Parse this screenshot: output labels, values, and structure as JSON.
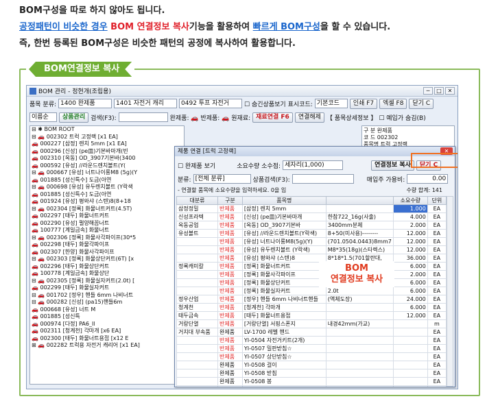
{
  "intro": {
    "line1": "BOM구성을 따로 하지 않아도 됩니다.",
    "line2_a": "공정패턴이 비슷한 경우",
    "line2_b": " BOM 연결정보 복사",
    "line2_c": "기능을 활용하여 ",
    "line2_d": "빠르게 BOM구성",
    "line2_e": "을 할 수 있습니다.",
    "line3": "즉, 한번 등록된 BOM구성은 비슷한 패턴의 공정에 복사하여 활용합니다."
  },
  "section_tag": "BOM연결정보 복사",
  "bom_window": {
    "title": "BOM 관리 - 정현개(조립용)",
    "window_buttons": [
      "─",
      "□",
      "✕"
    ],
    "toolbar1": {
      "category_label": "품목 분류:",
      "category_value": "1400 완제품",
      "sub1": "1401 자전거 캐리",
      "sub2": "0492 투프 자전거",
      "check_label": "☐ 숨긴상품보기",
      "display_code_label": "표시코드:",
      "display_code_value": "기본코드",
      "print": "인쇄 F7",
      "excel": "엑셀 F8",
      "close": "닫기 C"
    },
    "toolbar2": {
      "sort_value": "이름순",
      "product_manage": "상품관리",
      "search_label": "검색(F3):",
      "legend": "완제품: 🚗 반제품: 🚗 원재료:",
      "copy_btn": "재료연결 F6",
      "connect_btn": "연결해제",
      "detail": "【 품목상세정보 】",
      "input_check": "☐ 예입가 숨김(B)"
    },
    "right_panel": {
      "rows": [
        "구  분  완제품",
        "코  드  002302",
        "품목명  트럭 고정랙"
      ]
    },
    "tree": [
      "⊟ ✱ BOM ROOT",
      "  ⊟ 🚗 002302 트럭 고정랙 [x1 EA]",
      "      🚗 000227 [삼정] 렌치 5mm [x1 EA]",
      "      🚗 000296 [신성] (pe皿)기본바마개(빈",
      "      🚗 002310 [옥동] OD_3907기본바(3400",
      "      🚗 000592 [유성] //라운드렌치볼트(Y(",
      "    ⊟ 🚗 000667 [유성] 너트나이롱M8 (5g)(Y",
      "        🚗 001885 [성신특수] 도금(아연",
      "    ⊟ 🚗 000698 [유성] 유두렌치볼트 (Y락색",
      "        🚗 001885 [성신특수] 도금(아연",
      "      🚗 001924 [유성] 평와샤 (스텐)8(8+18",
      "    ⊟ 🚗 002304 [정록] 화물너트커트(4.5T)",
      "        🚗 002297 [태두] 화물너트커트",
      "        🚗 002290 [유성] 펄양해꼽너트",
      "        🚗 100777 [계일금속] 화물너트",
      "    ⊟ 🚗 002306 [정록] 화물사각파이프(30*5",
      "        🚗 002298 [태두] 화물각파이프",
      "        🚗 002307 [한양] 화물사각파이프",
      "    ⊟ 🚗 002303 [정록] 화물상단커트(6T) [x",
      "        🚗 002296 [태두] 화물상단커트",
      "        🚗 100778 [계일금속] 화물상단",
      "    ⊟ 🚗 002305 [정록] 화물실자커트(2.0t) [",
      "        🚗 002299 [태두] 화물실자커트",
      "    ⊟ 🚗 001702 [정우] 핸들 6mm 나비너트",
      "      ⊟ 🚗 000282 [신성] (pa15)핸들6m",
      "          🚗 000668 [유성] 너트 M",
      "            🚗 001885 [성신특",
      "          🚗 000974 [다정] PA6_Il",
      "      🚗 002311 [청계천] 각마개 [x6 EA]",
      "      🚗 002300 [태두] 화물너트용접 [x12 E",
      "  ⊞ 🚗 002282 트럭용 자전거 캐리어 [x1 EA]"
    ]
  },
  "dialog": {
    "title": "제품 연결 [트럭 고정랙]",
    "show_parts": "☐ 완제품 보기",
    "qty_label": "소요수량 소수점:",
    "qty_value": "세자리(1,000)",
    "copy_btn": "연결정보 복사",
    "close_btn": "닫기 C",
    "cat_label": "분류:",
    "cat_value": "[전체 분류]",
    "search_label": "상품검색(F3):",
    "price_label": "매입주 가용비:",
    "price_value": "0.00",
    "note": "- 연결할 품목에 소요수량을 입력하세요. 0을 입",
    "total": "수량 합계: 141",
    "headers": [
      "대분류",
      "구분",
      "품목명",
      "",
      "소요수량",
      "단위"
    ],
    "rows": [
      [
        "삼정정밀",
        "반제품",
        "[삼정] 렌치 5mm",
        "",
        "1.000",
        "EA"
      ],
      [
        "신성프라텍",
        "반제품",
        "[신성] (pe皿)기본바마개",
        "한참722_16g(사출)",
        "4.000",
        "EA"
      ],
      [
        "옥동공업",
        "반제품",
        "[옥동] OD_3907기본바",
        "3400mm분체",
        "2.000",
        "EA"
      ],
      [
        "유성볼트",
        "반제품",
        "[유성] //라운드렌치볼트(Y락색)",
        "8+50(미사용)--------",
        "12.000",
        "EA"
      ],
      [
        "",
        "반제품",
        "[유성] 너트나이롱M8(5g)(Y)",
        "(701.0504.0443)8mm7",
        "12.000",
        "EA"
      ],
      [
        "",
        "반제품",
        "[유성] 유두렌치볼트 (Y락색)",
        "M8*35(18g)(스타렉스)",
        "12.000",
        "EA"
      ],
      [
        "",
        "반제품",
        "[유성] 평와샤 (스텐)8",
        "8*18*1.5(701할란대,",
        "36.000",
        "EA"
      ],
      [
        "정록캐미칼",
        "반제품",
        "[정록] 화물너트커트",
        "4.5T",
        "6.000",
        "EA"
      ],
      [
        "",
        "반제품",
        "[정록] 화물사각파이프",
        "30*50*1.4t",
        "2.000",
        "EA"
      ],
      [
        "",
        "반제품",
        "[정록] 화물상단커트",
        "6T",
        "6.000",
        "EA"
      ],
      [
        "",
        "반제품",
        "[정록] 화물실자커트",
        "2.0t",
        "6.000",
        "EA"
      ],
      [
        "정우산업",
        "반제품",
        "[정우] 핸들 6mm 나비너트핸들",
        "(액체도장)",
        "24.000",
        "EA"
      ],
      [
        "청계천",
        "반제품",
        "[청계천] 각마개",
        "",
        "6.000",
        "EA"
      ],
      [
        "태두금속",
        "반제품",
        "[태두] 화물너트용접",
        "",
        "12.000",
        "EA"
      ],
      [
        "거랑단열",
        "반제품",
        "[거랑단열] 서핑스폰지",
        "내경42mm(가교)",
        "",
        "m"
      ],
      [
        "거치대 부속품",
        "완제품",
        "LV-1700 레벨 핸드",
        "",
        "",
        "EA"
      ],
      [
        "",
        "반제품",
        "YI-0504 자전거키트(2개)",
        "",
        "",
        "EA"
      ],
      [
        "",
        "반제품",
        "YI-0507 밀판받침☆",
        "",
        "",
        "EA"
      ],
      [
        "",
        "반제품",
        "YI-0507 상단받침☆",
        "",
        "",
        "EA"
      ],
      [
        "",
        "완제품",
        "YI-0508 걸이",
        "",
        "",
        "EA"
      ],
      [
        "",
        "완제품",
        "YI-0508 받침",
        "",
        "",
        "EA"
      ],
      [
        "",
        "완제품",
        "YI-0508 봉",
        "",
        "",
        "EA"
      ],
      [
        "",
        "완제품",
        "YI-052 파이프 옷걸이☆",
        "580*3",
        "",
        "EA"
      ]
    ]
  },
  "callout": {
    "line1": "BOM",
    "line2": "연결정보 복사"
  },
  "colors": {
    "frame": "#8aba5a",
    "tag": "#6fae32",
    "accent_red": "#e0202a",
    "accent_blue": "#1a66cc",
    "highlight": "#f07020"
  }
}
